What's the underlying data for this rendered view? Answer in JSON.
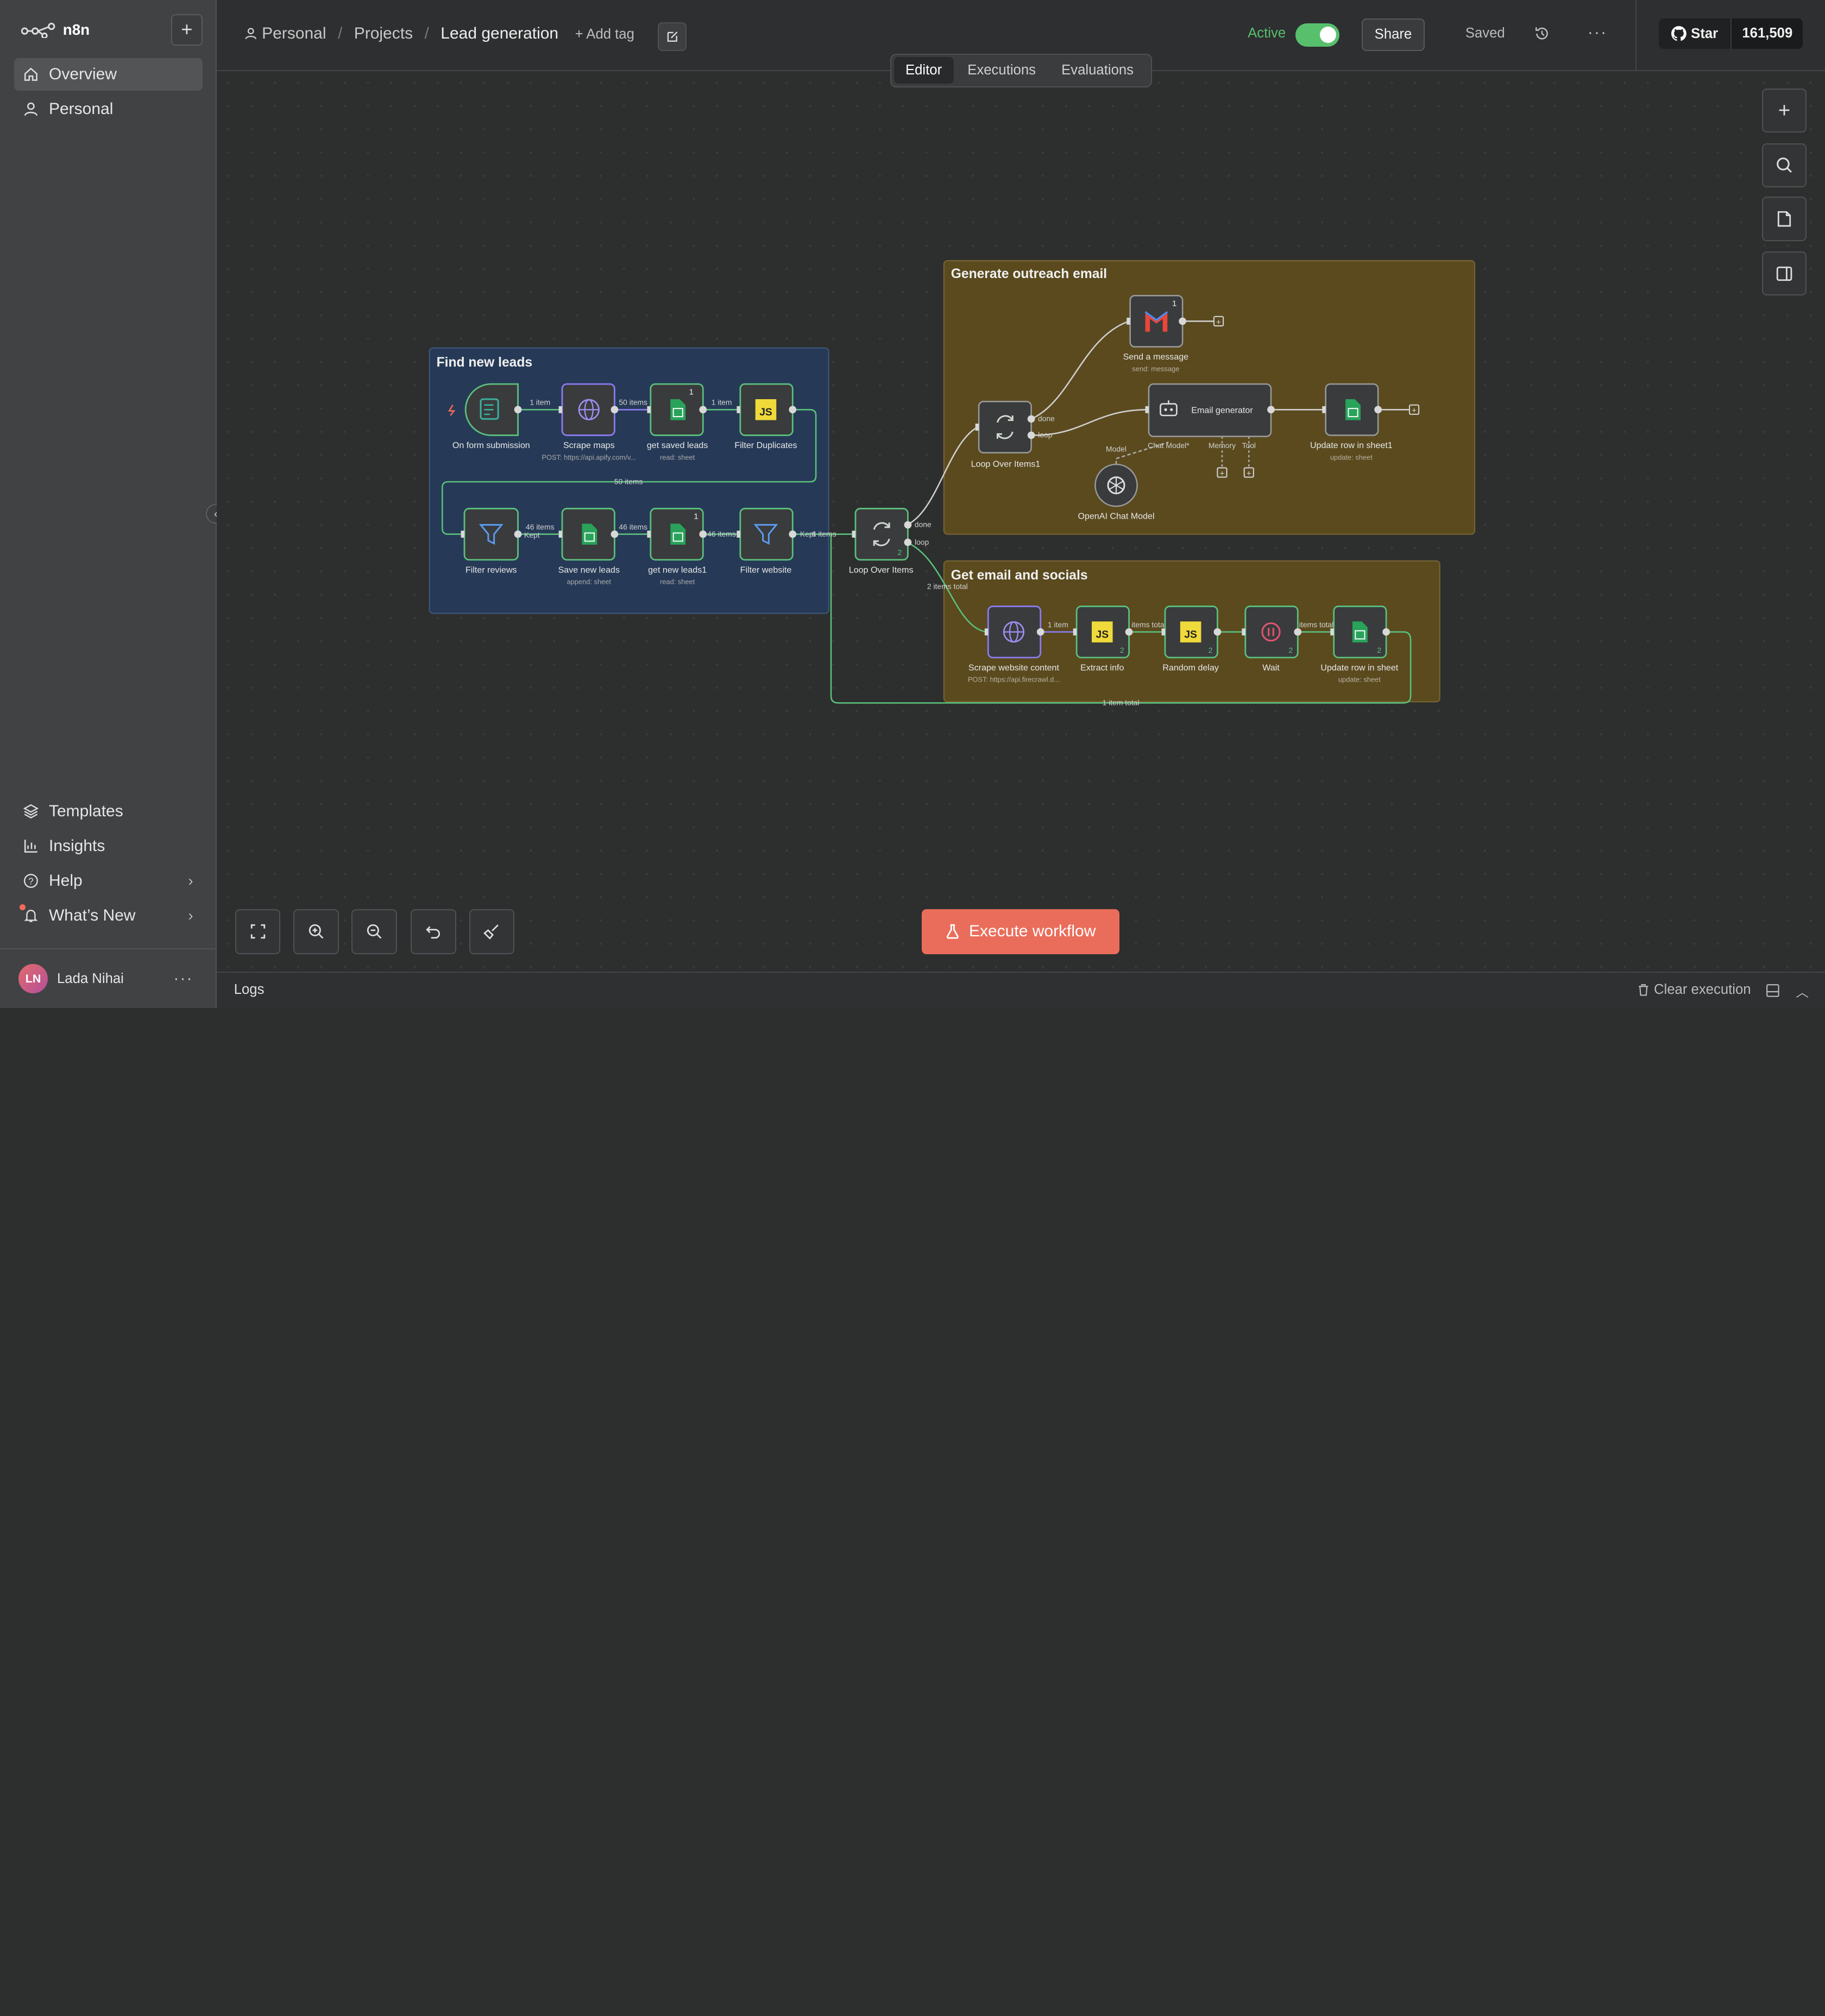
{
  "app": {
    "name": "n8n"
  },
  "sidebar": {
    "overview": "Overview",
    "personal": "Personal",
    "templates": "Templates",
    "insights": "Insights",
    "help": "Help",
    "whats_new": "What’s New",
    "user_initials": "LN",
    "user_name": "Lada Nihai"
  },
  "header": {
    "crumb_personal": "Personal",
    "crumb_projects": "Projects",
    "workflow_name": "Lead generation",
    "add_tag": "+ Add tag",
    "active_label": "Active",
    "share": "Share",
    "saved": "Saved",
    "github_star": "Star",
    "github_count": "161,509"
  },
  "tabs": [
    "Editor",
    "Executions",
    "Evaluations"
  ],
  "groups": {
    "find": "Find new leads",
    "outreach": "Generate outreach email",
    "socials": "Get email and socials"
  },
  "nodes": {
    "form": {
      "name": "On form submission"
    },
    "scrape_maps": {
      "name": "Scrape maps",
      "sub": "POST: https://api.apify.com/v..."
    },
    "get_saved": {
      "name": "get saved leads",
      "sub": "read: sheet",
      "badge": "1"
    },
    "filter_dup": {
      "name": "Filter Duplicates"
    },
    "filter_reviews": {
      "name": "Filter reviews"
    },
    "save_new": {
      "name": "Save new leads",
      "sub": "append: sheet"
    },
    "get_new1": {
      "name": "get new leads1",
      "sub": "read: sheet",
      "badge": "1"
    },
    "filter_web": {
      "name": "Filter website"
    },
    "loop": {
      "name": "Loop Over Items",
      "count": "2"
    },
    "loop1": {
      "name": "Loop Over Items1"
    },
    "send_msg": {
      "name": "Send a message",
      "sub": "send: message",
      "badge": "1"
    },
    "email_gen": {
      "name": "Email generator"
    },
    "update1": {
      "name": "Update row in sheet1",
      "sub": "update: sheet"
    },
    "openai": {
      "name": "OpenAI Chat Model"
    },
    "scrape_web": {
      "name": "Scrape website content",
      "sub": "POST: https://api.firecrawl.d..."
    },
    "extract": {
      "name": "Extract info",
      "count": "2"
    },
    "delay": {
      "name": "Random delay",
      "count": "2"
    },
    "wait": {
      "name": "Wait",
      "count": "2"
    },
    "update": {
      "name": "Update row in sheet",
      "sub": "update: sheet",
      "count": "2"
    }
  },
  "edges": {
    "e1": "1 item",
    "e2": "50 items",
    "e3": "1 item",
    "e4": "50 items",
    "e5": "46 items",
    "e5b": "Kept",
    "e6": "46 items",
    "e7": "46 items",
    "e8": "6 items",
    "e8b": "Kept",
    "done": "done",
    "loop": "loop",
    "total": "2 items total",
    "s1": "1 item",
    "s2": "items total",
    "s3": "items total",
    "back": "1 item total",
    "model": "Model",
    "chatmodel": "Chat Model*",
    "memory": "Memory",
    "tool": "Tool"
  },
  "canvas": {
    "execute": "Execute workflow"
  },
  "logs": {
    "label": "Logs",
    "clear": "Clear execution"
  },
  "colors": {
    "accent": "#ea6d5b",
    "active_green": "#58c06d",
    "group_blue": "#263a57",
    "group_olive": "#5a4a1e"
  }
}
